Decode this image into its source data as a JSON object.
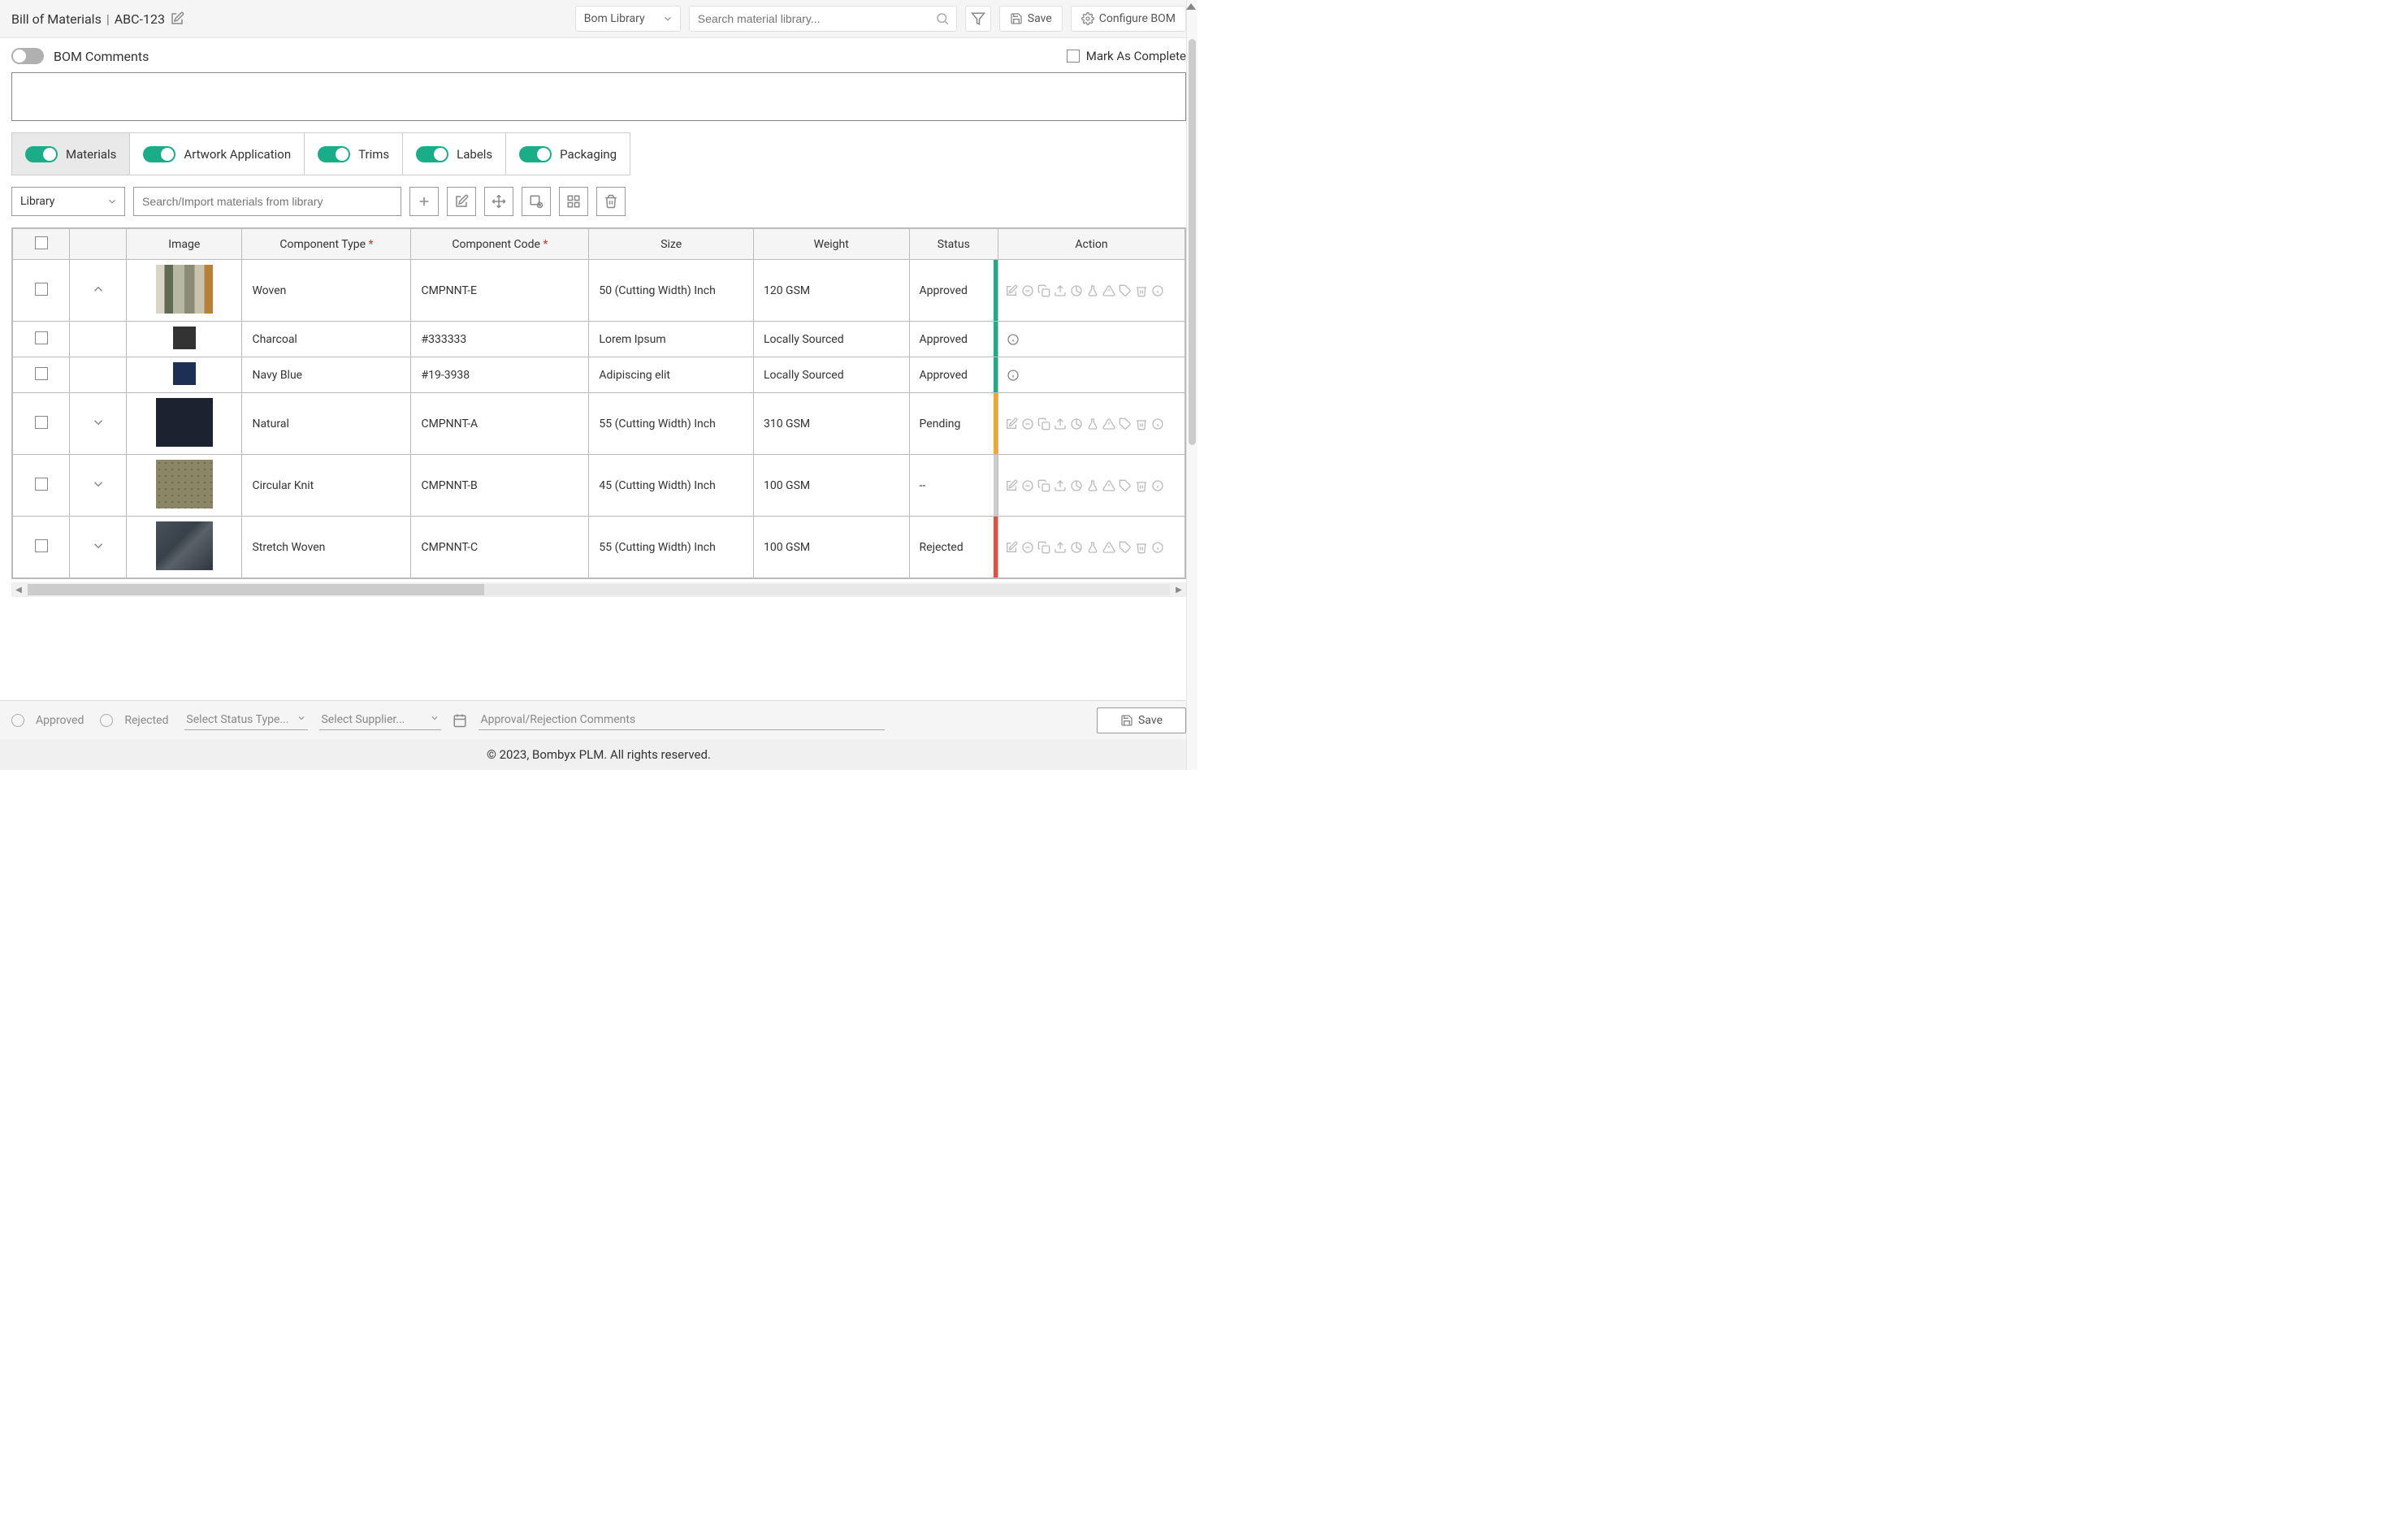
{
  "header": {
    "title_prefix": "Bill of Materials",
    "title_code": "ABC-123",
    "lib_select": "Bom Library",
    "search_placeholder": "Search material library...",
    "save_label": "Save",
    "configure_label": "Configure BOM"
  },
  "comments": {
    "toggle_label": "BOM Comments",
    "mark_complete_label": "Mark As Complete"
  },
  "tabs": [
    {
      "label": "Materials",
      "active": true
    },
    {
      "label": "Artwork Application",
      "active": false
    },
    {
      "label": "Trims",
      "active": false
    },
    {
      "label": "Labels",
      "active": false
    },
    {
      "label": "Packaging",
      "active": false
    }
  ],
  "library_bar": {
    "dropdown_label": "Library",
    "search_placeholder": "Search/Import materials from library"
  },
  "columns": {
    "image": "Image",
    "component_type": "Component Type",
    "component_code": "Component Code",
    "size": "Size",
    "weight": "Weight",
    "status": "Status",
    "action": "Action"
  },
  "rows": [
    {
      "expand": "up",
      "swatch": "big",
      "swatch_style": "fabric-rolls",
      "type": "Woven",
      "code": "CMPNNT-E",
      "size": "50 (Cutting Width) Inch",
      "weight": "120 GSM",
      "status": "Approved",
      "status_color": "#1aae88",
      "actions": "full"
    },
    {
      "expand": "none",
      "swatch": "sm",
      "swatch_color": "#333333",
      "type": "Charcoal",
      "code": "#333333",
      "size": "Lorem Ipsum",
      "weight": "Locally Sourced",
      "status": "Approved",
      "status_color": "#1aae88",
      "actions": "info"
    },
    {
      "expand": "none",
      "swatch": "sm",
      "swatch_color": "#1d2f55",
      "type": "Navy Blue",
      "code": "#19-3938",
      "size": "Adipiscing elit",
      "weight": "Locally Sourced",
      "status": "Approved",
      "status_color": "#1aae88",
      "actions": "info"
    },
    {
      "expand": "down",
      "swatch": "big",
      "swatch_color": "#1c2230",
      "type": "Natural",
      "code": "CMPNNT-A",
      "size": "55 (Cutting Width) Inch",
      "weight": "310 GSM",
      "status": "Pending",
      "status_color": "#f5a623",
      "actions": "full"
    },
    {
      "expand": "down",
      "swatch": "big",
      "swatch_style": "dotted-khaki",
      "type": "Circular Knit",
      "code": "CMPNNT-B",
      "size": "45 (Cutting Width) Inch",
      "weight": "100 GSM",
      "status": "--",
      "status_color": "#ccc",
      "actions": "full"
    },
    {
      "expand": "down",
      "swatch": "big",
      "swatch_style": "grey-fabric",
      "type": "Stretch Woven",
      "code": "CMPNNT-C",
      "size": "55 (Cutting Width) Inch",
      "weight": "100 GSM",
      "status": "Rejected",
      "status_color": "#e74c3c",
      "actions": "full"
    }
  ],
  "approval": {
    "approved_label": "Approved",
    "rejected_label": "Rejected",
    "status_type_placeholder": "Select Status Type...",
    "supplier_placeholder": "Select Supplier...",
    "comments_placeholder": "Approval/Rejection Comments",
    "save_label": "Save"
  },
  "footer": "© 2023, Bombyx PLM. All rights reserved."
}
